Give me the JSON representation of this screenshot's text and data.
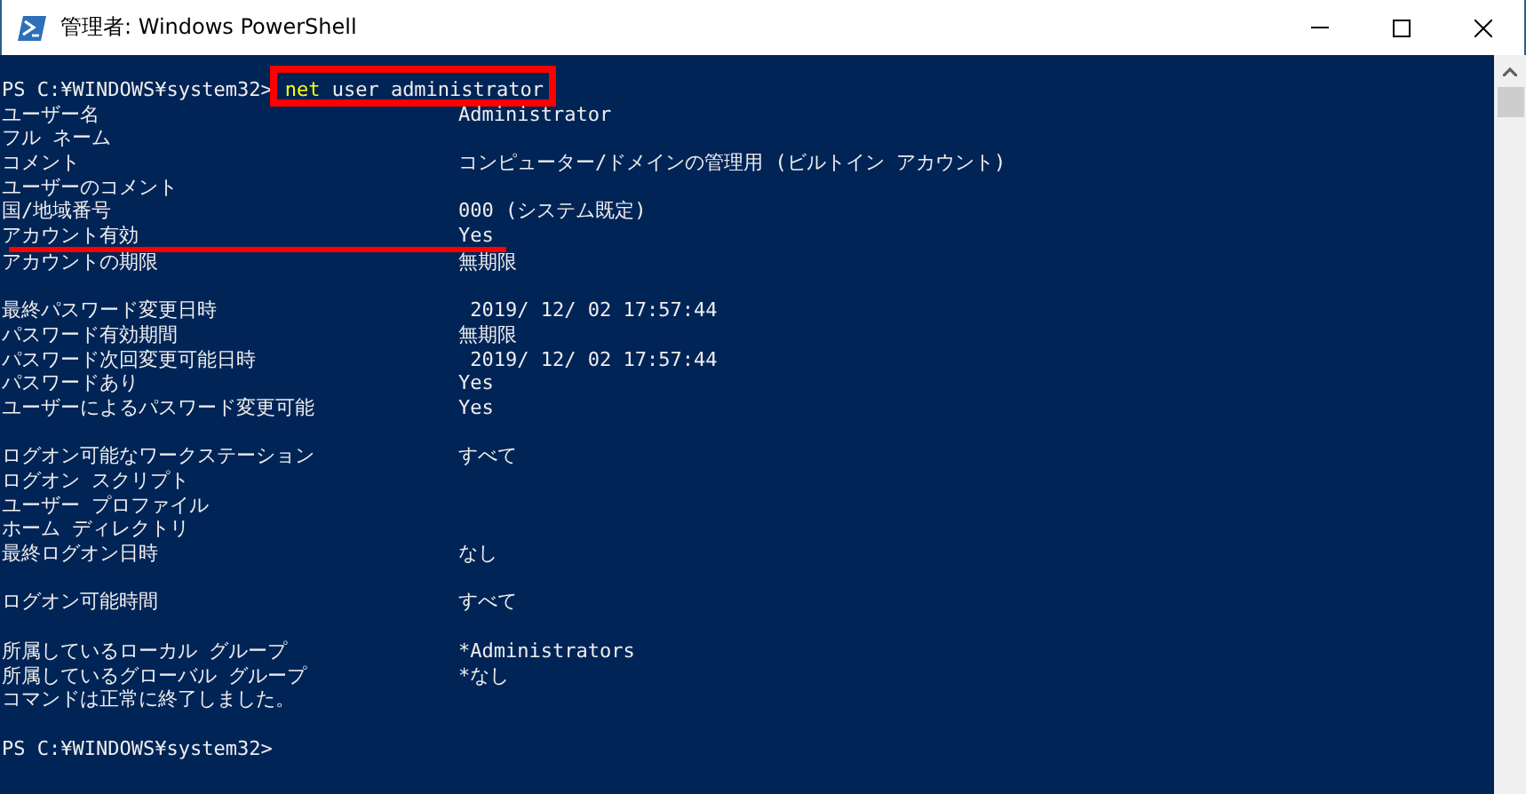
{
  "window": {
    "title": "管理者: Windows PowerShell"
  },
  "lines": [
    {
      "kind": "prompt",
      "prompt": "PS C:¥WINDOWS¥system32>",
      "command": [
        {
          "kind": "cmdlet",
          "text": "net"
        },
        {
          "kind": "argument",
          "text": "user administrator"
        }
      ],
      "boxed": true
    },
    {
      "kind": "field",
      "label": "ユーザー名",
      "value": "Administrator",
      "underlined": false
    },
    {
      "kind": "field",
      "label": "フル ネーム",
      "underlined": false
    },
    {
      "kind": "field",
      "label": "コメント",
      "value": "コンピューター/ドメインの管理用 (ビルトイン アカウント)",
      "underlined": false
    },
    {
      "kind": "field",
      "label": "ユーザーのコメント",
      "underlined": false
    },
    {
      "kind": "field",
      "label": "国/地域番号",
      "value": "000 (システム既定)",
      "underlined": false
    },
    {
      "kind": "field",
      "label": "アカウント有効",
      "value": "Yes",
      "underlined": true
    },
    {
      "kind": "field",
      "label": "アカウントの期限",
      "value": "無期限",
      "underlined": false
    },
    {
      "kind": "blank"
    },
    {
      "kind": "field",
      "label": "最終パスワード変更日時",
      "value": " 2019/ 12/ 02 17:57:44",
      "underlined": false
    },
    {
      "kind": "field",
      "label": "パスワード有効期間",
      "value": "無期限",
      "underlined": false
    },
    {
      "kind": "field",
      "label": "パスワード次回変更可能日時",
      "value": " 2019/ 12/ 02 17:57:44",
      "underlined": false
    },
    {
      "kind": "field",
      "label": "パスワードあり",
      "value": "Yes",
      "underlined": false
    },
    {
      "kind": "field",
      "label": "ユーザーによるパスワード変更可能",
      "value": "Yes",
      "underlined": false
    },
    {
      "kind": "blank"
    },
    {
      "kind": "field",
      "label": "ログオン可能なワークステーション",
      "value": "すべて",
      "underlined": false
    },
    {
      "kind": "field",
      "label": "ログオン スクリプト",
      "underlined": false
    },
    {
      "kind": "field",
      "label": "ユーザー プロファイル",
      "underlined": false
    },
    {
      "kind": "field",
      "label": "ホーム ディレクトリ",
      "underlined": false
    },
    {
      "kind": "field",
      "label": "最終ログオン日時",
      "value": "なし",
      "underlined": false
    },
    {
      "kind": "blank"
    },
    {
      "kind": "field",
      "label": "ログオン可能時間",
      "value": "すべて",
      "underlined": false
    },
    {
      "kind": "blank"
    },
    {
      "kind": "field",
      "label": "所属しているローカル グループ",
      "value": "*Administrators",
      "underlined": false
    },
    {
      "kind": "field",
      "label": "所属しているグローバル グループ",
      "value": "*なし",
      "underlined": false
    },
    {
      "kind": "message",
      "text": "コマンドは正常に終了しました。"
    },
    {
      "kind": "blank"
    },
    {
      "kind": "prompt",
      "prompt": "PS C:¥WINDOWS¥system32>"
    }
  ]
}
